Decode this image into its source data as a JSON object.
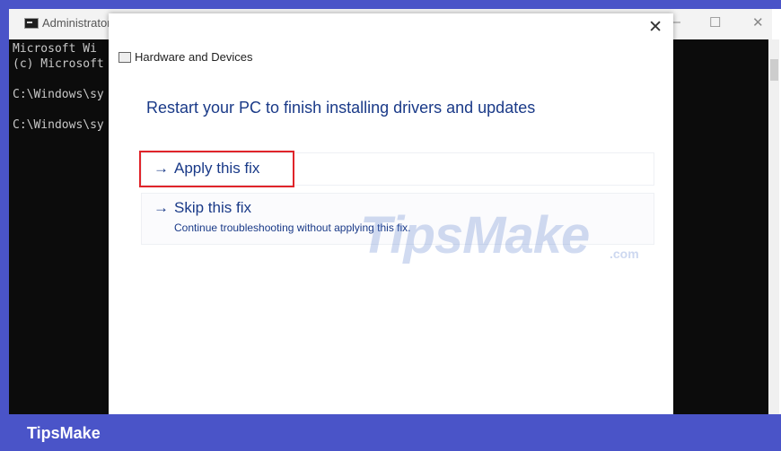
{
  "console": {
    "title": "Administrator",
    "lines": [
      "Microsoft Wi",
      "(c) Microsoft",
      "",
      "C:\\Windows\\sy",
      "",
      "C:\\Windows\\sy"
    ],
    "minimize_glyph": "—",
    "maximize_glyph": "☐",
    "close_glyph": "✕"
  },
  "dialog": {
    "title": "Hardware and Devices",
    "close_glyph": "✕",
    "heading": "Restart your PC to finish installing drivers and updates",
    "options": [
      {
        "arrow": "→",
        "label": "Apply this fix"
      },
      {
        "arrow": "→",
        "label": "Skip this fix",
        "description": "Continue troubleshooting without applying this fix."
      }
    ]
  },
  "watermark": {
    "main": "TipsMake",
    "suffix": ".com"
  },
  "footer": {
    "brand": "TipsMake"
  },
  "colors": {
    "frame": "#4a54c8",
    "accent_text": "#1a3a88",
    "highlight": "#e0242a"
  },
  "icons": [
    "cmd-icon",
    "troubleshooter-icon",
    "arrow-right-icon",
    "close-icon"
  ]
}
